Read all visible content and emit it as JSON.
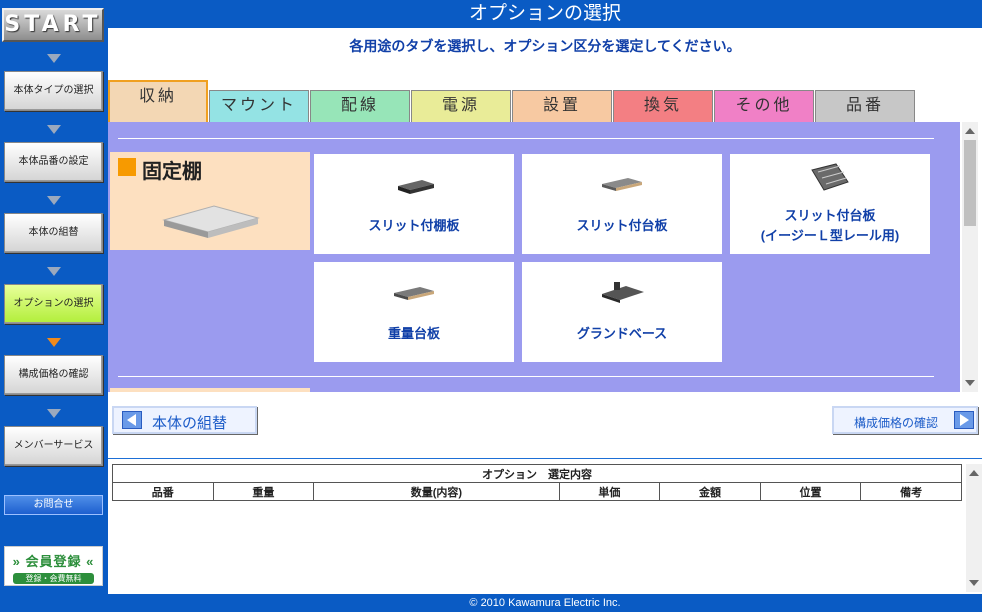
{
  "header": {
    "title": "オプションの選択"
  },
  "sidebar": {
    "start_label": "START",
    "steps": [
      {
        "label": "本体タイプの選択"
      },
      {
        "label": "本体品番の設定"
      },
      {
        "label": "本体の組替"
      },
      {
        "label": "オプションの選択",
        "active": true
      },
      {
        "label": "構成価格の確認"
      },
      {
        "label": "メンバーサービス"
      }
    ],
    "contact_label": "お問合せ",
    "member_banner": {
      "title": "» 会員登録 «",
      "subtitle": "登録・会費無料"
    }
  },
  "main": {
    "instruction": "各用途のタブを選択し、オプション区分を選定してください。",
    "tabs": [
      {
        "label": "収納",
        "color": "#f3d7b4",
        "active": true
      },
      {
        "label": "マウント",
        "color": "#94e3e4"
      },
      {
        "label": "配線",
        "color": "#97e5b8"
      },
      {
        "label": "電源",
        "color": "#e9ec98"
      },
      {
        "label": "設置",
        "color": "#f7c9a2"
      },
      {
        "label": "換気",
        "color": "#f37f83"
      },
      {
        "label": "その他",
        "color": "#f080c6"
      },
      {
        "label": "品番",
        "color": "#c7c7c7"
      }
    ],
    "category": {
      "title": "固定棚",
      "swatch_color": "#f79a00"
    },
    "cards": [
      {
        "line1": "スリット付棚板",
        "line2": ""
      },
      {
        "line1": "スリット付台板",
        "line2": ""
      },
      {
        "line1": "スリット付台板",
        "line2": "(イージーＬ型レール用)"
      },
      {
        "line1": "重量台板",
        "line2": ""
      },
      {
        "line1": "グランドベース",
        "line2": ""
      }
    ],
    "back_button": "本体の組替",
    "next_button": "構成価格の確認",
    "selection_table": {
      "caption": "オプション　選定内容",
      "columns": [
        "品番",
        "重量",
        "数量(内容)",
        "単価",
        "金額",
        "位置",
        "備考"
      ]
    }
  },
  "footer": {
    "copyright": "© 2010 Kawamura Electric Inc."
  },
  "colors": {
    "brand_blue": "#0a5bc4",
    "panel_purple": "#9b9bef",
    "link_blue": "#1140a8"
  }
}
